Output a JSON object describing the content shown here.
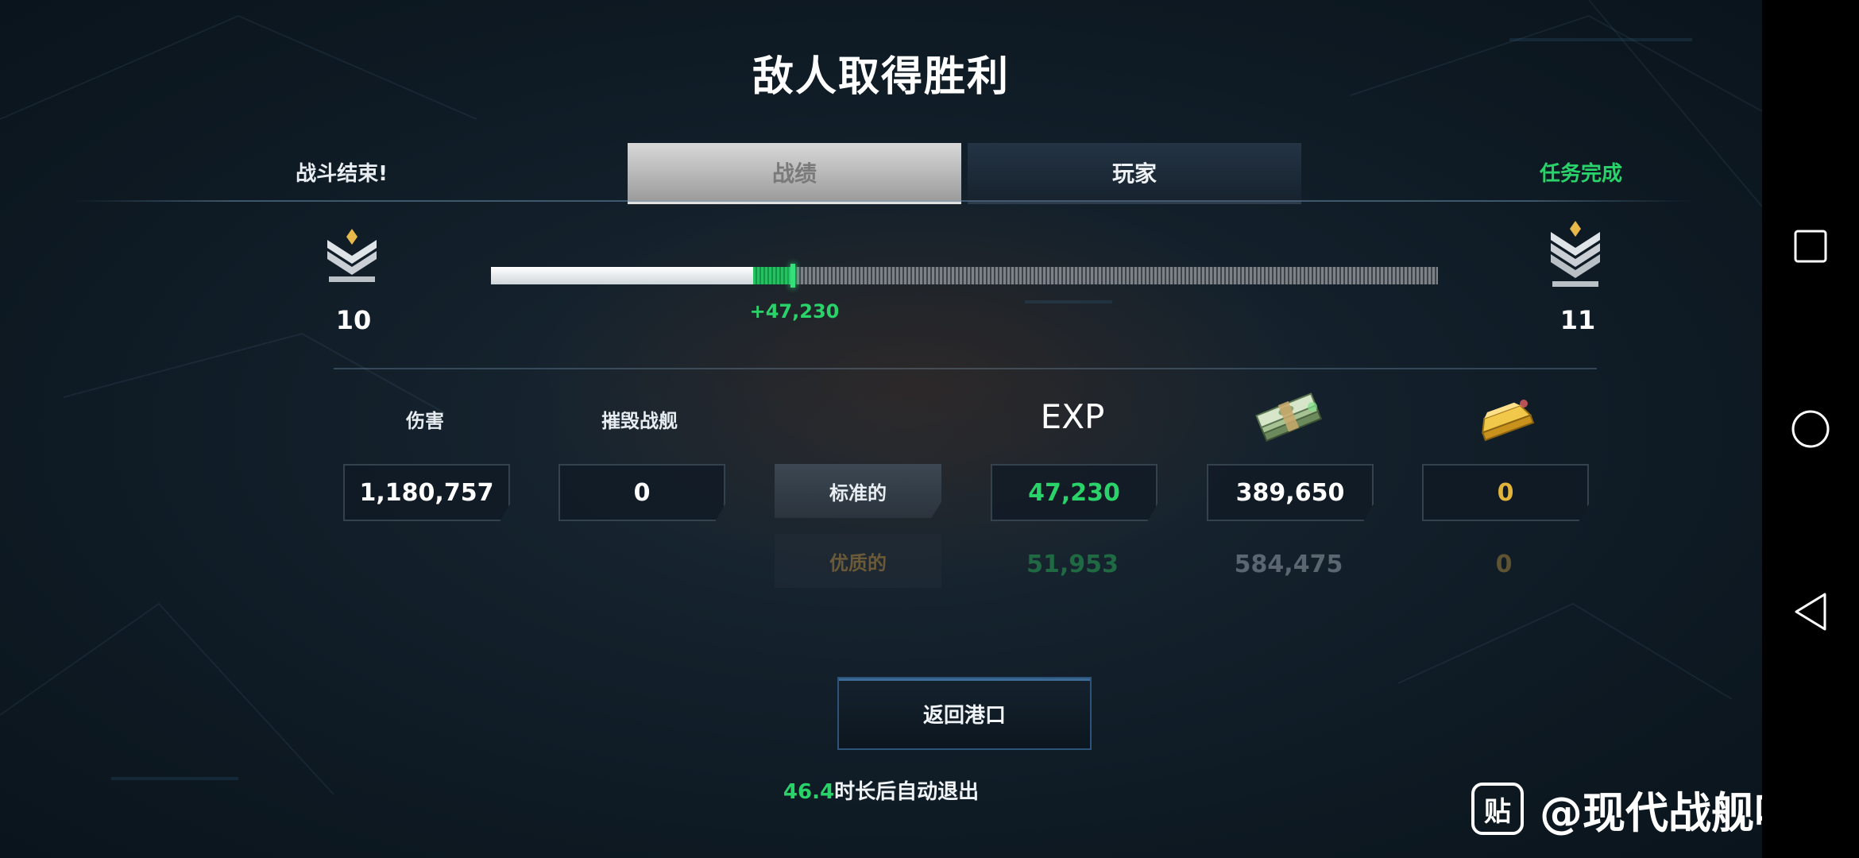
{
  "header": {
    "title": "敌人取得胜利",
    "left_status": "战斗结束!",
    "right_status": "任务完成"
  },
  "tabs": [
    {
      "label": "战绩",
      "active": true
    },
    {
      "label": "玩家",
      "active": false
    }
  ],
  "progress": {
    "current_rank": "10",
    "next_rank": "11",
    "base_fraction": 0.277,
    "gain_fraction": 0.042,
    "gain_label": "+47,230"
  },
  "columns": {
    "damage": "伤害",
    "kills": "摧毁战舰",
    "exp": "EXP",
    "cash_icon": "cash-stack-icon",
    "gold_icon": "gold-bar-icon"
  },
  "standard_row": {
    "label": "标准的",
    "damage": "1,180,757",
    "kills": "0",
    "exp": "47,230",
    "cash": "389,650",
    "gold": "0"
  },
  "premium_row": {
    "label": "优质的",
    "exp": "51,953",
    "cash": "584,475",
    "gold": "0"
  },
  "footer": {
    "return_button": "返回港口",
    "countdown": "46.4",
    "auto_exit_text": "时长后自动退出"
  },
  "watermark": {
    "logo_char": "贴",
    "text": "@现代战舰吧"
  },
  "system_nav": {
    "icons": [
      "recent-apps-icon",
      "home-icon",
      "back-icon"
    ]
  },
  "colors": {
    "accent_green": "#2ad26a",
    "gold": "#e2b43a",
    "premium_exp": "#1f6a43",
    "premium_cash": "#5c6670",
    "premium_gold": "#5e5434"
  }
}
